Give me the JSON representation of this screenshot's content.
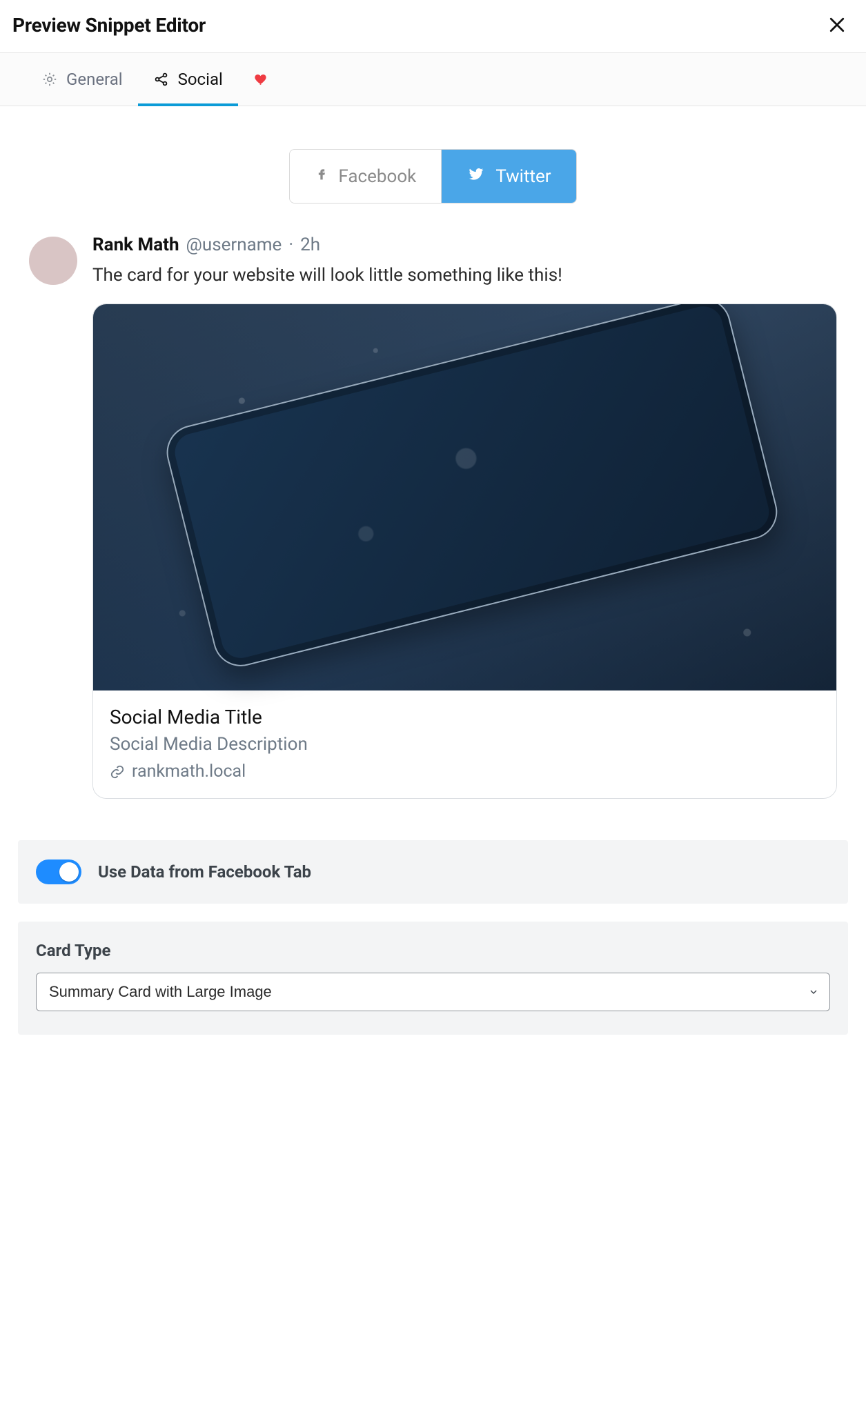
{
  "header": {
    "title": "Preview Snippet Editor"
  },
  "tabs": {
    "general": {
      "label": "General"
    },
    "social": {
      "label": "Social"
    },
    "active": "social"
  },
  "platform": {
    "facebook": {
      "label": "Facebook"
    },
    "twitter": {
      "label": "Twitter"
    },
    "active": "twitter"
  },
  "tweet": {
    "name": "Rank Math",
    "handle": "@username",
    "separator": "·",
    "age": "2h",
    "text": "The card for your website will look little something like this!",
    "card": {
      "title": "Social Media Title",
      "description": "Social Media Description",
      "domain": "rankmath.local"
    }
  },
  "settings": {
    "use_fb": {
      "label": "Use Data from Facebook Tab",
      "on": true
    },
    "card_type": {
      "label": "Card Type",
      "value": "Summary Card with Large Image"
    }
  },
  "colors": {
    "accent": "#0b9bd7",
    "twitter": "#4aa6e8",
    "toggle": "#1e8cff",
    "heart": "#ef3b42"
  }
}
